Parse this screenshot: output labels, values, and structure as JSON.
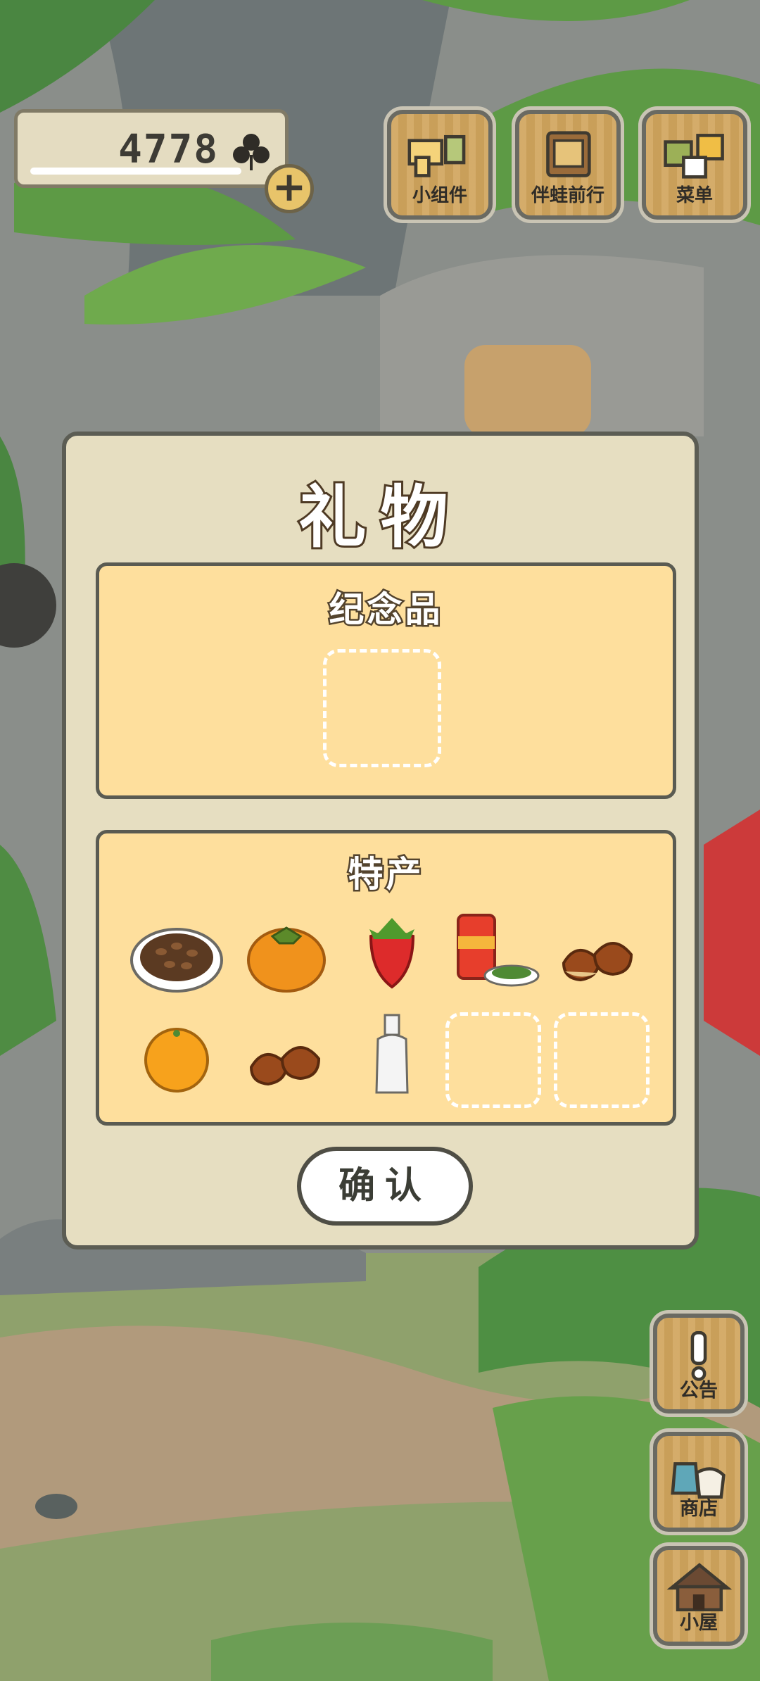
{
  "hud": {
    "clover_count": "4778",
    "plus_label": "+"
  },
  "top_menu": [
    {
      "label": "小组件",
      "icon": "widget-icon"
    },
    {
      "label": "伴蛙前行",
      "icon": "journal-icon"
    },
    {
      "label": "菜单",
      "icon": "menu-icon"
    }
  ],
  "side_menu": [
    {
      "label": "公告",
      "icon": "exclamation-icon"
    },
    {
      "label": "商店",
      "icon": "shop-bag-icon"
    },
    {
      "label": "小屋",
      "icon": "house-icon"
    }
  ],
  "dialog": {
    "title": "礼物",
    "souvenir_title": "纪念品",
    "specialty_title": "特产",
    "specialty_items": [
      {
        "name": "coffee-beans-plate"
      },
      {
        "name": "persimmon"
      },
      {
        "name": "strawberry"
      },
      {
        "name": "tea-can-and-leaves"
      },
      {
        "name": "chestnuts"
      },
      {
        "name": "orange"
      },
      {
        "name": "chestnuts"
      },
      {
        "name": "glass-bottle"
      }
    ],
    "confirm_label": "确认"
  }
}
